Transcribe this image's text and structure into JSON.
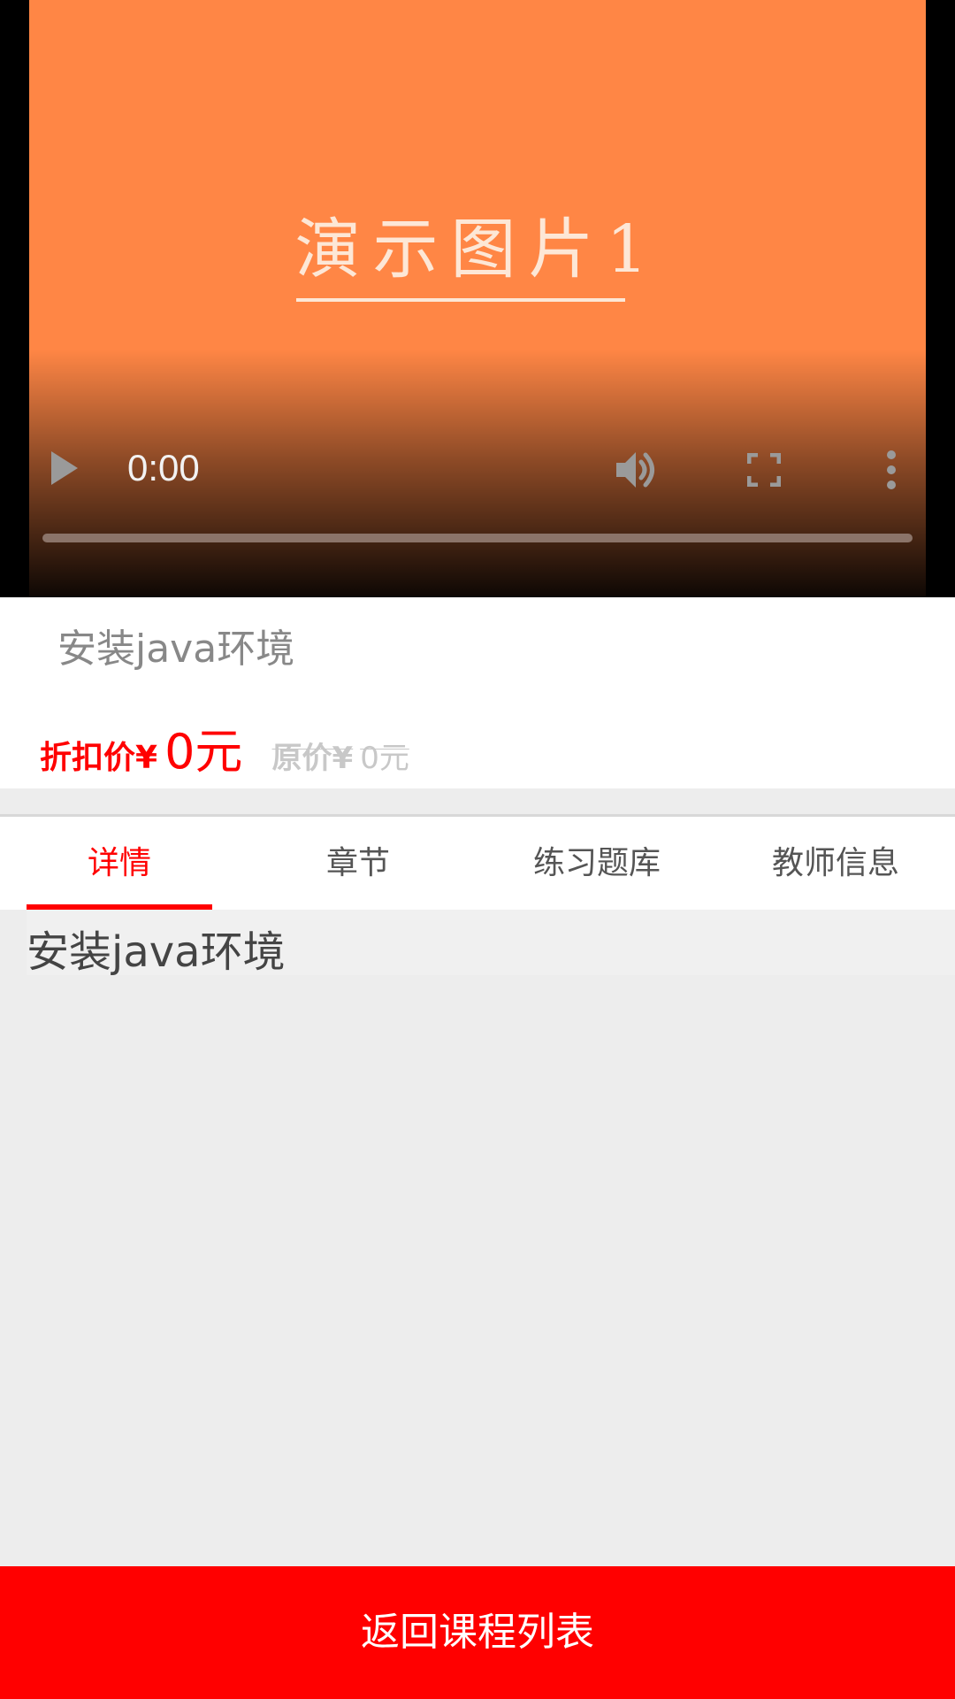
{
  "video": {
    "poster_text": "演示图片1",
    "current_time": "0:00",
    "progress": 0
  },
  "course": {
    "title": "安装java环境",
    "discount_label": "折扣价¥",
    "discount_price": "0元",
    "original_label": "原价¥",
    "original_price": "0元"
  },
  "tabs": [
    {
      "label": "详情",
      "active": true
    },
    {
      "label": "章节",
      "active": false
    },
    {
      "label": "练习题库",
      "active": false
    },
    {
      "label": "教师信息",
      "active": false
    }
  ],
  "detail": {
    "text": "安装java环境"
  },
  "footer": {
    "back_label": "返回课程列表"
  },
  "colors": {
    "accent": "#ff0000",
    "poster": "#ff8645"
  }
}
